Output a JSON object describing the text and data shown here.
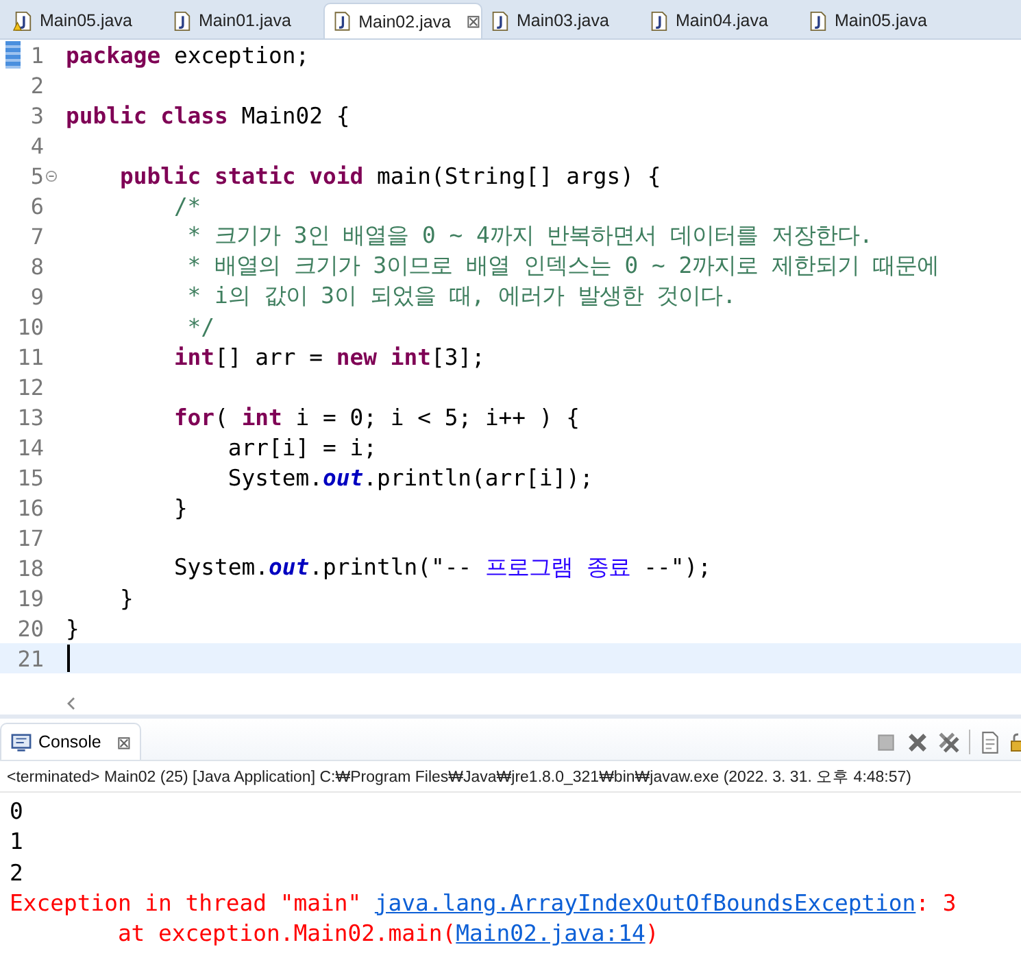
{
  "tabs": [
    {
      "label": "Main05.java",
      "selected": false,
      "warning": true
    },
    {
      "label": "Main01.java",
      "selected": false,
      "warning": false
    },
    {
      "label": "Main02.java",
      "selected": true,
      "warning": false
    },
    {
      "label": "Main03.java",
      "selected": false,
      "warning": false
    },
    {
      "label": "Main04.java",
      "selected": false,
      "warning": false
    },
    {
      "label": "Main05.java",
      "selected": false,
      "warning": false
    }
  ],
  "close_icon": "⊠",
  "editor": {
    "lines": [
      {
        "number": "1",
        "marker": true,
        "fold": false,
        "current": false,
        "tokens": [
          {
            "t": "package",
            "kind": "kw"
          },
          {
            "t": " exception;",
            "kind": "plain"
          }
        ]
      },
      {
        "number": "2",
        "marker": false,
        "fold": false,
        "current": false
      },
      {
        "number": "3",
        "marker": false,
        "fold": false,
        "current": false,
        "tokens": [
          {
            "t": "public class",
            "kind": "kw"
          },
          {
            "t": " Main02 {",
            "kind": "plain"
          }
        ]
      },
      {
        "number": "4",
        "marker": false,
        "fold": false,
        "current": false
      },
      {
        "number": "5",
        "marker": false,
        "fold": true,
        "current": false,
        "tokens": [
          {
            "t": "    public static void",
            "kind": "kw"
          },
          {
            "t": " main(String[] args) {",
            "kind": "plain"
          }
        ]
      },
      {
        "number": "6",
        "marker": false,
        "fold": false,
        "current": false,
        "tokens": [
          {
            "t": "        /*",
            "kind": "comment"
          }
        ]
      },
      {
        "number": "7",
        "marker": false,
        "fold": false,
        "current": false,
        "tokens": [
          {
            "t": "         * 크기가 3인 배열을 0 ~ 4까지 반복하면서 데이터를 저장한다.",
            "kind": "comment"
          }
        ]
      },
      {
        "number": "8",
        "marker": false,
        "fold": false,
        "current": false,
        "tokens": [
          {
            "t": "         * 배열의 크기가 3이므로 배열 인덱스는 0 ~ 2까지로 제한되기 때문에",
            "kind": "comment"
          }
        ]
      },
      {
        "number": "9",
        "marker": false,
        "fold": false,
        "current": false,
        "tokens": [
          {
            "t": "         * i의 값이 3이 되었을 때, 에러가 발생한 것이다.",
            "kind": "comment"
          }
        ]
      },
      {
        "number": "10",
        "marker": false,
        "fold": false,
        "current": false,
        "tokens": [
          {
            "t": "         */",
            "kind": "comment"
          }
        ]
      },
      {
        "number": "11",
        "marker": false,
        "fold": false,
        "current": false,
        "tokens": [
          {
            "t": "        int",
            "kind": "kw"
          },
          {
            "t": "[] arr = ",
            "kind": "plain"
          },
          {
            "t": "new int",
            "kind": "kw"
          },
          {
            "t": "[3];",
            "kind": "plain"
          }
        ]
      },
      {
        "number": "12",
        "marker": false,
        "fold": false,
        "current": false
      },
      {
        "number": "13",
        "marker": false,
        "fold": false,
        "current": false,
        "tokens": [
          {
            "t": "        for",
            "kind": "kw"
          },
          {
            "t": "( ",
            "kind": "plain"
          },
          {
            "t": "int",
            "kind": "kw"
          },
          {
            "t": " i = 0; i < 5; i++ ) {",
            "kind": "plain"
          }
        ]
      },
      {
        "number": "14",
        "marker": false,
        "fold": false,
        "current": false,
        "tokens": [
          {
            "t": "            arr[i] = i;",
            "kind": "plain"
          }
        ]
      },
      {
        "number": "15",
        "marker": false,
        "fold": false,
        "current": false,
        "tokens": [
          {
            "t": "            System.",
            "kind": "plain"
          },
          {
            "t": "out",
            "kind": "field"
          },
          {
            "t": ".println(arr[i]);",
            "kind": "plain"
          }
        ]
      },
      {
        "number": "16",
        "marker": false,
        "fold": false,
        "current": false,
        "tokens": [
          {
            "t": "        }",
            "kind": "plain"
          }
        ]
      },
      {
        "number": "17",
        "marker": false,
        "fold": false,
        "current": false
      },
      {
        "number": "18",
        "marker": false,
        "fold": false,
        "current": false,
        "tokens": [
          {
            "t": "        System.",
            "kind": "plain"
          },
          {
            "t": "out",
            "kind": "field"
          },
          {
            "t": ".println(\"-- ",
            "kind": "plain"
          },
          {
            "t": "프로그램 종료",
            "kind": "string"
          },
          {
            "t": " --\");",
            "kind": "plain"
          }
        ]
      },
      {
        "number": "19",
        "marker": false,
        "fold": false,
        "current": false,
        "tokens": [
          {
            "t": "    }",
            "kind": "plain"
          }
        ]
      },
      {
        "number": "20",
        "marker": false,
        "fold": false,
        "current": false,
        "tokens": [
          {
            "t": "}",
            "kind": "plain"
          }
        ]
      },
      {
        "number": "21",
        "marker": false,
        "fold": false,
        "current": true
      }
    ]
  },
  "console": {
    "tab_label": "Console",
    "close_icon": "⊠",
    "status": "<terminated> Main02 (25) [Java Application] C:₩Program Files₩Java₩jre1.8.0_321₩bin₩javaw.exe (2022. 3. 31. 오후 4:48:57)",
    "output": [
      {
        "kind": "out",
        "parts": [
          {
            "t": "0",
            "link": false
          }
        ]
      },
      {
        "kind": "out",
        "parts": [
          {
            "t": "1",
            "link": false
          }
        ]
      },
      {
        "kind": "out",
        "parts": [
          {
            "t": "2",
            "link": false
          }
        ]
      },
      {
        "kind": "err",
        "parts": [
          {
            "t": "Exception in thread \"main\" ",
            "link": false
          },
          {
            "t": "java.lang.ArrayIndexOutOfBoundsException",
            "link": true
          },
          {
            "t": ": 3",
            "link": false
          }
        ]
      },
      {
        "kind": "err",
        "parts": [
          {
            "t": "        at exception.Main02.main(",
            "link": false
          },
          {
            "t": "Main02.java:14",
            "link": true
          },
          {
            "t": ")",
            "link": false
          }
        ]
      }
    ]
  }
}
